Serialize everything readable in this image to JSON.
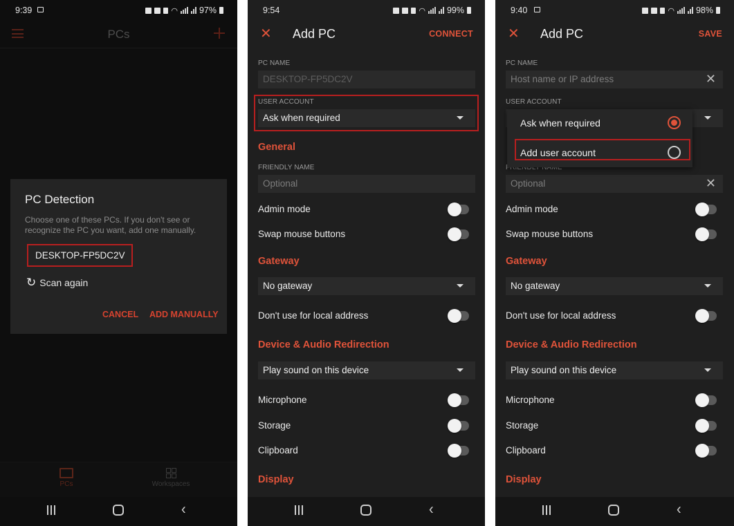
{
  "colors": {
    "accent": "#e0533a",
    "highlight": "#b81f1f",
    "background": "#1f1f1f"
  },
  "screens": [
    {
      "status": {
        "time": "9:39",
        "battery": "97%"
      },
      "appbar": {
        "title": "PCs",
        "menu_icon": "hamburger-icon",
        "add_icon": "plus-icon"
      },
      "dialog": {
        "title": "PC Detection",
        "body": "Choose one of these PCs. If you don't see or recognize the PC you want, add one manually.",
        "pc_item": "DESKTOP-FP5DC2V",
        "scan_label": "Scan again",
        "cancel_label": "CANCEL",
        "add_manually_label": "ADD MANUALLY"
      },
      "bottom_tabs": [
        {
          "label": "PCs",
          "icon": "pcs-icon",
          "active": true
        },
        {
          "label": "Workspaces",
          "icon": "workspaces-icon",
          "active": false
        }
      ]
    },
    {
      "status": {
        "time": "9:54",
        "battery": "99%"
      },
      "appbar": {
        "title": "Add PC",
        "action": "CONNECT"
      },
      "pc_name": {
        "label": "PC NAME",
        "value": "DESKTOP-FP5DC2V"
      },
      "user_account": {
        "label": "USER ACCOUNT",
        "value": "Ask when required"
      },
      "general": {
        "heading": "General",
        "friendly_name_label": "FRIENDLY NAME",
        "friendly_name_placeholder": "Optional",
        "admin_mode": {
          "label": "Admin mode",
          "on": false
        },
        "swap_mouse": {
          "label": "Swap mouse buttons",
          "on": false
        }
      },
      "gateway": {
        "heading": "Gateway",
        "value": "No gateway",
        "local_address": {
          "label": "Don't use for local address",
          "on": false
        }
      },
      "device_audio": {
        "heading": "Device & Audio Redirection",
        "sound_value": "Play sound on this device",
        "microphone": {
          "label": "Microphone",
          "on": false
        },
        "storage": {
          "label": "Storage",
          "on": false
        },
        "clipboard": {
          "label": "Clipboard",
          "on": false
        }
      },
      "display": {
        "heading": "Display"
      }
    },
    {
      "status": {
        "time": "9:40",
        "battery": "98%"
      },
      "appbar": {
        "title": "Add PC",
        "action": "SAVE"
      },
      "pc_name": {
        "label": "PC NAME",
        "placeholder": "Host name or IP address"
      },
      "user_account": {
        "label": "USER ACCOUNT"
      },
      "popup": {
        "options": [
          {
            "label": "Ask when required",
            "selected": true
          },
          {
            "label": "Add user account",
            "selected": false
          }
        ]
      },
      "general": {
        "friendly_name_label": "FRIENDLY NAME",
        "friendly_name_placeholder": "Optional",
        "admin_mode": {
          "label": "Admin mode",
          "on": false
        },
        "swap_mouse": {
          "label": "Swap mouse buttons",
          "on": false
        }
      },
      "gateway": {
        "heading": "Gateway",
        "value": "No gateway",
        "local_address": {
          "label": "Don't use for local address",
          "on": false
        }
      },
      "device_audio": {
        "heading": "Device & Audio Redirection",
        "sound_value": "Play sound on this device",
        "microphone": {
          "label": "Microphone",
          "on": false
        },
        "storage": {
          "label": "Storage",
          "on": false
        },
        "clipboard": {
          "label": "Clipboard",
          "on": false
        }
      },
      "display": {
        "heading": "Display"
      }
    }
  ]
}
